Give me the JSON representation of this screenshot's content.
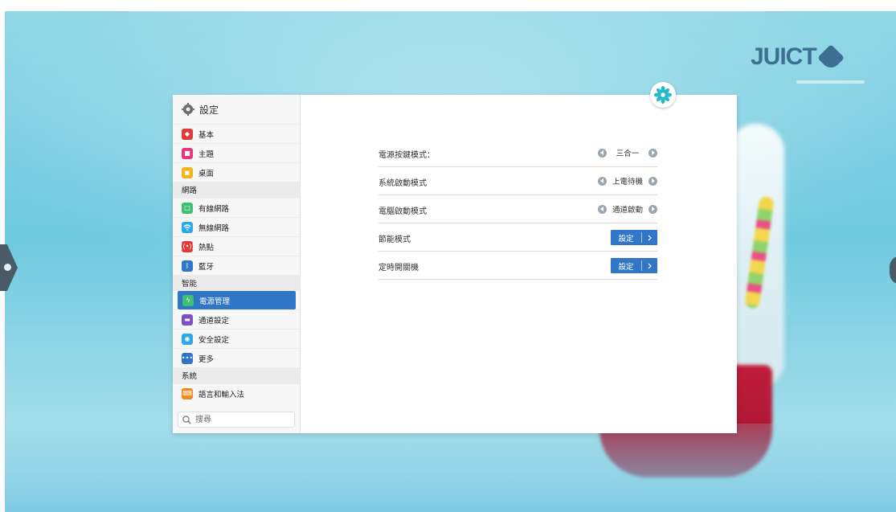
{
  "sidebar": {
    "title": "設定",
    "items": [
      {
        "label": "基本",
        "icon": "layers-icon",
        "color": "#e03a3a"
      },
      {
        "label": "主題",
        "icon": "shirt-icon",
        "color": "#e8357f"
      },
      {
        "label": "桌面",
        "icon": "image-icon",
        "color": "#f0b51e"
      }
    ],
    "section_network": "網路",
    "network_items": [
      {
        "label": "有線網路",
        "icon": "ethernet-icon",
        "color": "#3fbf72"
      },
      {
        "label": "無線網路",
        "icon": "wifi-icon",
        "color": "#2fa9e6"
      },
      {
        "label": "熱點",
        "icon": "hotspot-icon",
        "color": "#e03a3a"
      },
      {
        "label": "藍牙",
        "icon": "bluetooth-icon",
        "color": "#2f76c6"
      }
    ],
    "section_smart": "智能",
    "smart_items": [
      {
        "label": "電源管理",
        "icon": "lightning-icon",
        "color": "#3fbf72",
        "active": true
      },
      {
        "label": "通道設定",
        "icon": "monitor-icon",
        "color": "#7d4fc2"
      },
      {
        "label": "安全設定",
        "icon": "shield-icon",
        "color": "#2fa9e6"
      },
      {
        "label": "更多",
        "icon": "more-icon",
        "color": "#2f76c6"
      }
    ],
    "section_system": "系統",
    "system_items": [
      {
        "label": "語言和輸入法",
        "icon": "keyboard-icon",
        "color": "#f08a1e"
      }
    ],
    "search_placeholder": "搜尋"
  },
  "content": {
    "rows": [
      {
        "label": "電源按鍵模式：",
        "value": "三合一",
        "type": "selector"
      },
      {
        "label": "系統啟動模式",
        "value": "上電待機",
        "type": "selector"
      },
      {
        "label": "電腦啟動模式",
        "value": "通道啟動",
        "type": "selector"
      },
      {
        "label": "節能模式",
        "button": "設定",
        "type": "button"
      },
      {
        "label": "定時開關機",
        "button": "設定",
        "type": "button"
      }
    ]
  },
  "colors": {
    "accent": "#2f76c6",
    "button": "#3277c6"
  }
}
